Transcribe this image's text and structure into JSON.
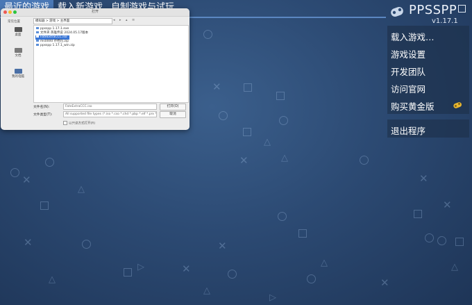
{
  "tabs": [
    "最近的游戏",
    "载入新游戏",
    "自制游戏与试玩"
  ],
  "logo": {
    "name": "PPSSPP",
    "version": "v1.17.1"
  },
  "menu": {
    "load_game": "载入游戏…",
    "game_settings": "游戏设置",
    "dev_team": "开发团队",
    "visit_site": "访问官网",
    "buy_gold": "购买黄金版",
    "exit": "退出程序"
  },
  "dialog": {
    "title": "打开",
    "sidebar_label": "常见位置",
    "sidebar_items": [
      "桌面",
      "文档",
      "我的电脑"
    ],
    "path": "模拟器 > 游戏 > 主界面",
    "files": [
      "ppsspp 1.17.1.exe",
      "文件夹 英雄传说 2024.05.17版本",
      "FateExtraCCC.iso",
      "ms0000 存档包.zip",
      "ppsspp 1.17.1_win.zip"
    ],
    "selected_index": 2,
    "filename_label": "文件名(N):",
    "filename_value": "FateExtraCCC.iso",
    "filetype_label": "文件类型(T):",
    "filetype_value": "All supported file types (*.iso *.cso *.chd *.pbp *.elf *.prx *.zip *.ppdmp)",
    "open_button": "打开(O)",
    "cancel_button": "取消",
    "readonly_label": "以只读方式打开(R)"
  },
  "colors": {
    "tab_active": "#4a78b5",
    "menu_bg": "#1c2d46",
    "selection": "#3a76d6",
    "background": "#2c4a73"
  }
}
